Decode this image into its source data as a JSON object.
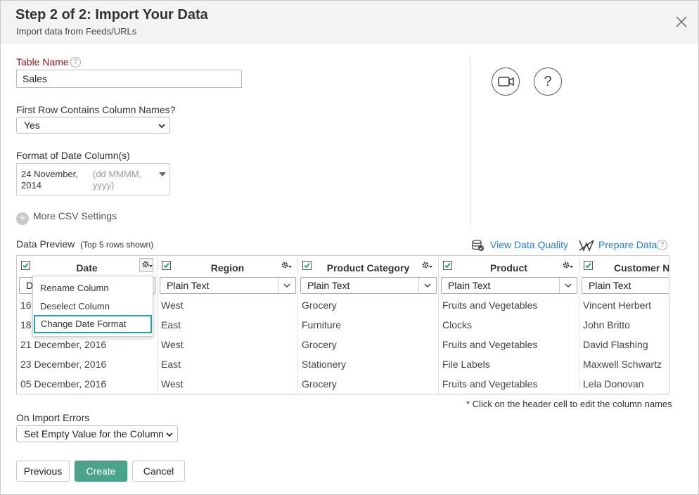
{
  "dialog": {
    "title": "Step 2 of 2: Import Your Data",
    "subtitle": "Import data from Feeds/URLs"
  },
  "form": {
    "table_name_label": "Table Name",
    "table_name_value": "Sales",
    "first_row_label": "First Row Contains Column Names?",
    "first_row_value": "Yes",
    "date_format_label": "Format of Date Column(s)",
    "date_format_value_line1": "24 November,",
    "date_format_value_line2": "2014",
    "date_format_hint_line1": "(dd MMMM,",
    "date_format_hint_line2": "yyyy)",
    "more_csv_label": "More CSV Settings",
    "help_glyph": "?"
  },
  "preview": {
    "title": "Data Preview",
    "subtitle": "(Top 5 rows shown)",
    "view_quality_label": "View Data Quality",
    "prepare_data_label": "Prepare Data",
    "footnote": "* Click on the header cell to edit the column names",
    "columns": [
      {
        "name": "Date",
        "type": "D"
      },
      {
        "name": "Region",
        "type": "Plain Text"
      },
      {
        "name": "Product Category",
        "type": "Plain Text"
      },
      {
        "name": "Product",
        "type": "Plain Text"
      },
      {
        "name": "Customer Na",
        "type": "Plain Text"
      }
    ],
    "rows": [
      [
        "16",
        "West",
        "Grocery",
        "Fruits and Vegetables",
        "Vincent Herbert"
      ],
      [
        "18",
        "East",
        "Furniture",
        "Clocks",
        "John Britto"
      ],
      [
        "21 December, 2016",
        "West",
        "Grocery",
        "Fruits and Vegetables",
        "David Flashing"
      ],
      [
        "23 December, 2016",
        "East",
        "Stationery",
        "File Labels",
        "Maxwell Schwartz"
      ],
      [
        "05 December, 2016",
        "West",
        "Grocery",
        "Fruits and Vegetables",
        "Lela Donovan"
      ]
    ]
  },
  "context_menu": {
    "items": [
      "Rename Column",
      "Deselect Column",
      "Change Date Format"
    ],
    "active_index": 2
  },
  "errors": {
    "label": "On Import Errors",
    "value": "Set Empty Value for the Column"
  },
  "buttons": {
    "previous": "Previous",
    "create": "Create",
    "cancel": "Cancel"
  },
  "icons": {
    "close": "close-icon",
    "video": "video-icon",
    "help": "help-icon",
    "gear": "gear-icon",
    "database_check": "database-check-icon",
    "prepare": "prepare-data-icon"
  },
  "colors": {
    "primary": "#4ba38a",
    "link": "#2f7bbf",
    "required_label": "#8b1a1a",
    "menu_highlight": "#1fa5a5"
  }
}
